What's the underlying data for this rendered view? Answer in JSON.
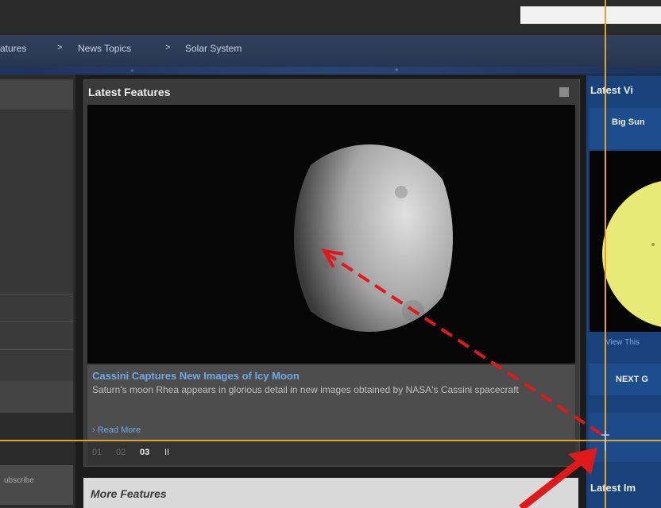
{
  "breadcrumb": {
    "items": [
      "atures",
      "News Topics",
      "Solar System"
    ],
    "separator": ">"
  },
  "left": {
    "subscribe_label": "ubscribe"
  },
  "feature_panel": {
    "title": "Latest Features",
    "caption_title": "Cassini Captures New Images of Icy Moon",
    "caption_text": "Saturn's moon Rhea appears in glorious detail in new images obtained by NASA's Cassini spacecraft",
    "read_more": "› Read More",
    "pager": [
      "01",
      "02",
      "03"
    ],
    "pager_current": "03",
    "pause_glyph": "II"
  },
  "more_features": {
    "title": "More Features"
  },
  "right": {
    "title": "Latest Vi",
    "subtitle": "Big Sun",
    "view_this": "View This",
    "next_label": "NEXT G",
    "title2": "Latest Im"
  },
  "colors": {
    "accent_link": "#6fa9e8",
    "guide_line": "#e3a32a",
    "annotation_red": "#e0191a",
    "right_panel_blue": "#19427a"
  },
  "icons": [
    "rss-icon",
    "pause-icon",
    "sun-image",
    "moon-image"
  ]
}
